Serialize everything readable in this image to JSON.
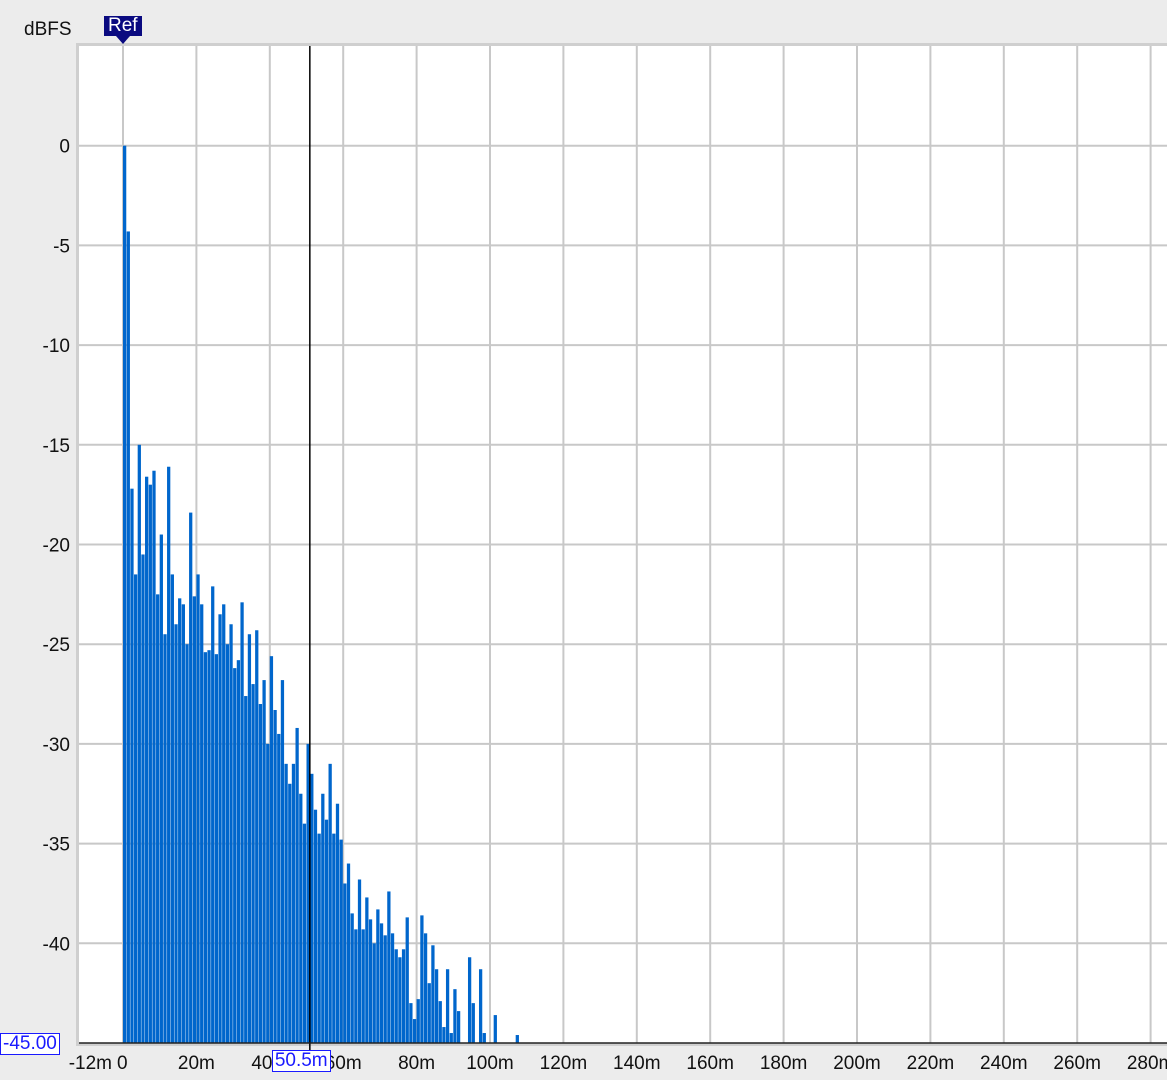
{
  "chart_data": {
    "type": "bar",
    "title": "",
    "ylabel": "dBFS",
    "xlabel": "",
    "xlim": [
      -12,
      284
    ],
    "ylim": [
      -45,
      5
    ],
    "grid": true,
    "x_ticks": [
      "-12m",
      "0",
      "20m",
      "40m",
      "60m",
      "80m",
      "100m",
      "120m",
      "140m",
      "160m",
      "180m",
      "200m",
      "220m",
      "240m",
      "260m",
      "280m"
    ],
    "x_tick_values": [
      -12,
      0,
      20,
      40,
      60,
      80,
      100,
      120,
      140,
      160,
      180,
      200,
      220,
      240,
      260,
      280
    ],
    "y_ticks": [
      "0",
      "-5",
      "-10",
      "-15",
      "-20",
      "-25",
      "-30",
      "-35",
      "-40"
    ],
    "y_tick_values": [
      0,
      -5,
      -10,
      -15,
      -20,
      -25,
      -30,
      -35,
      -40
    ],
    "bar_color": "#0066cc",
    "x_unit": "ms",
    "x": [
      0,
      1,
      2,
      3,
      4,
      5,
      6,
      7,
      8,
      9,
      10,
      11,
      12,
      13,
      14,
      15,
      16,
      17,
      18,
      19,
      20,
      21,
      22,
      23,
      24,
      25,
      26,
      27,
      28,
      29,
      30,
      31,
      32,
      33,
      34,
      35,
      36,
      37,
      38,
      39,
      40,
      41,
      42,
      43,
      44,
      45,
      46,
      47,
      48,
      49,
      50,
      51,
      52,
      53,
      54,
      55,
      56,
      57,
      58,
      59,
      60,
      61,
      62,
      63,
      64,
      65,
      66,
      67,
      68,
      69,
      70,
      71,
      72,
      73,
      74,
      75,
      76,
      77,
      78,
      79,
      80,
      81,
      82,
      83,
      84,
      85,
      86,
      87,
      88,
      89,
      90,
      91,
      92,
      93,
      94,
      95,
      96,
      97,
      98,
      99,
      100,
      101,
      102,
      103,
      104,
      105,
      106,
      107
    ],
    "values": [
      0,
      -4.3,
      -17.2,
      -21.5,
      -15,
      -20.5,
      -16.6,
      -17,
      -16.3,
      -22.5,
      -19.5,
      -24.5,
      -16.1,
      -21.5,
      -24,
      -22.7,
      -23,
      -25,
      -18.4,
      -22.6,
      -21.5,
      -23,
      -25.4,
      -25.3,
      -22.1,
      -25.5,
      -23.5,
      -23,
      -25,
      -24,
      -26.2,
      -25.8,
      -22.9,
      -27.6,
      -24.5,
      -27,
      -24.3,
      -28,
      -26.8,
      -30,
      -25.6,
      -28.3,
      -29.5,
      -26.8,
      -31,
      -32,
      -31,
      -29.2,
      -32.5,
      -34,
      -30,
      -31.5,
      -33.3,
      -34.5,
      -32.5,
      -33.8,
      -31,
      -34.5,
      -33,
      -34.8,
      -37,
      -36,
      -38.5,
      -39.3,
      -36.8,
      -39.3,
      -37.7,
      -38.8,
      -40,
      -38.3,
      -39,
      -39.6,
      -37.4,
      -39.5,
      -40.3,
      -40.7,
      -40.3,
      -38.7,
      -43,
      -43.8,
      -42.8,
      -38.6,
      -39.5,
      -42,
      -40.1,
      -41.3,
      -42.9,
      -44.2,
      -41.3,
      -44.5,
      -42.3,
      -43.4,
      -45,
      -45,
      -40.7,
      -43,
      -45,
      -41.3,
      -44.5,
      -45,
      -45,
      -43.6,
      -45,
      -45,
      -45,
      -45,
      -45,
      -44.6
    ],
    "reference_marker": {
      "label": "Ref",
      "x": 0
    },
    "cursor": {
      "x": 50.5,
      "x_readout": "50.5m",
      "y_readout": "-45.00"
    }
  }
}
